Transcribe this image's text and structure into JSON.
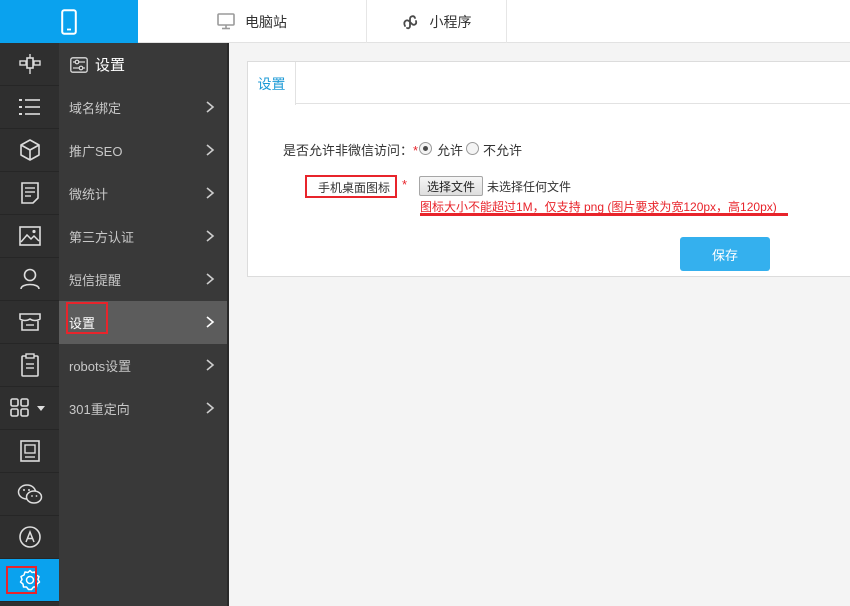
{
  "topbar": {
    "tabs": [
      {
        "label": "",
        "icon": "mobile-icon"
      },
      {
        "label": "电脑站",
        "icon": "monitor-icon"
      },
      {
        "label": "小程序",
        "icon": "mini-program-icon"
      }
    ]
  },
  "rail": {
    "items": [
      {
        "icon": "satellite-icon"
      },
      {
        "icon": "list-icon"
      },
      {
        "icon": "cube-icon"
      },
      {
        "icon": "document-icon"
      },
      {
        "icon": "image-icon"
      },
      {
        "icon": "user-icon"
      },
      {
        "icon": "store-icon"
      },
      {
        "icon": "clipboard-icon"
      },
      {
        "icon": "apps-grid-icon"
      },
      {
        "icon": "picture-frame-icon"
      },
      {
        "icon": "wechat-icon"
      },
      {
        "icon": "app-store-icon"
      },
      {
        "icon": "gear-icon"
      }
    ]
  },
  "submenu": {
    "title": "设置",
    "items": [
      {
        "label": "域名绑定"
      },
      {
        "label": "推广SEO"
      },
      {
        "label": "微统计"
      },
      {
        "label": "第三方认证"
      },
      {
        "label": "短信提醒"
      },
      {
        "label": "设置"
      },
      {
        "label": "robots设置"
      },
      {
        "label": "301重定向"
      }
    ]
  },
  "panel": {
    "tab_label": "设置",
    "wechat_access_label": "是否允许非微信访问：",
    "required_mark": "*",
    "radio_allow": "允许",
    "radio_disallow": "不允许",
    "icon_label": "手机桌面图标",
    "file_button": "选择文件",
    "file_status": "未选择任何文件",
    "hint": "图标大小不能超过1M，仅支持 png (图片要求为宽120px，高120px)",
    "save_label": "保存"
  },
  "colors": {
    "accent": "#0aa2ee",
    "rail_bg": "#2f2f2f",
    "submenu_bg": "#393939",
    "highlight": "#e8242b",
    "save_button": "#34b0ee"
  }
}
